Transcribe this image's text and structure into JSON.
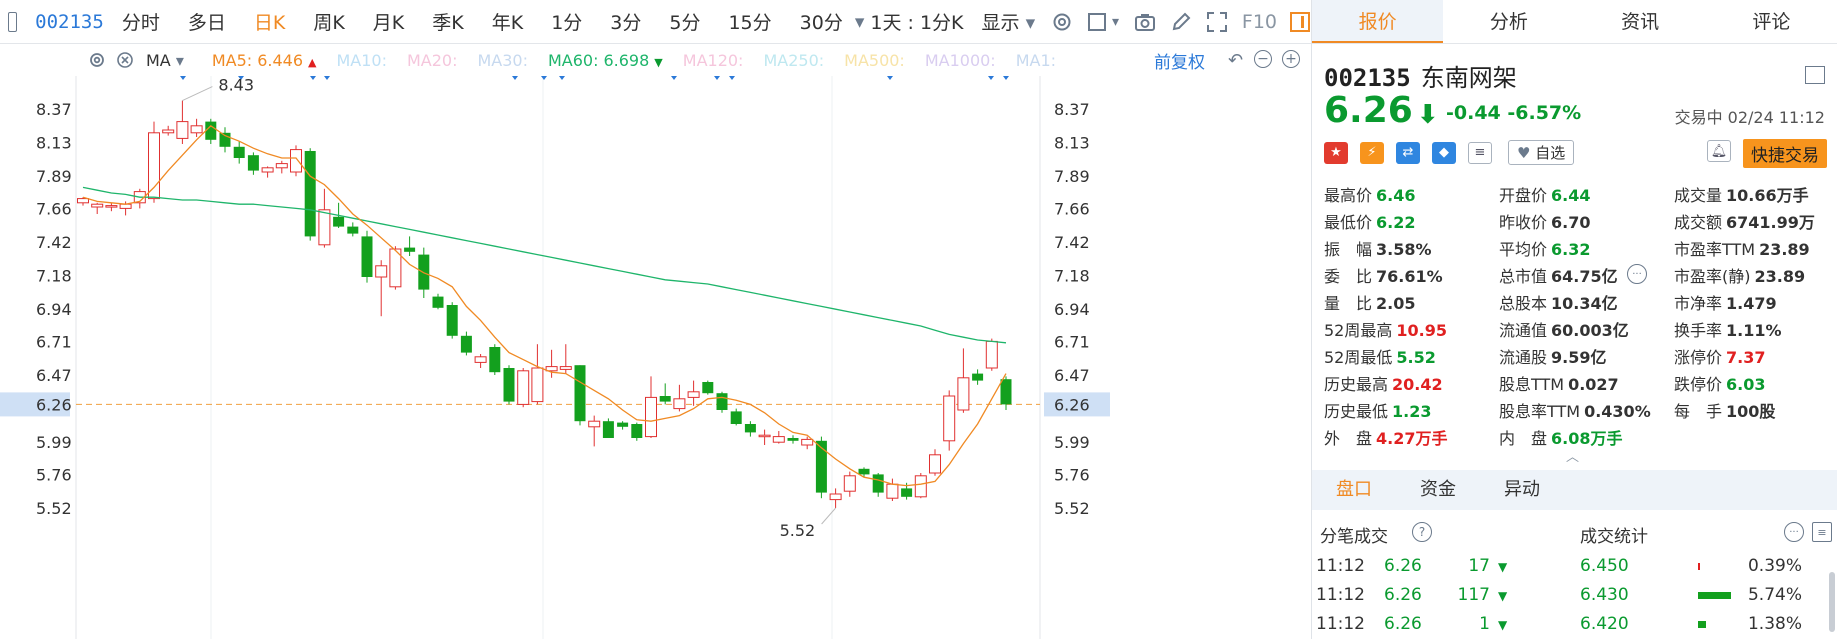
{
  "toolbar": {
    "code": "002135",
    "tabs": [
      "分时",
      "多日",
      "日K",
      "周K",
      "月K",
      "季K",
      "年K",
      "1分",
      "3分",
      "5分",
      "15分",
      "30分"
    ],
    "active_tab": "日K",
    "period_select": "1天 : 1分K",
    "display_label": "显示",
    "f10_label": "F10"
  },
  "mabar": {
    "indicator": "MA",
    "items": [
      {
        "label": "MA5:",
        "value": "6.446",
        "color": "#f08a24",
        "arrow": "▲",
        "arrow_color": "#e02020"
      },
      {
        "label": "MA10:",
        "value": "",
        "color": "#bfe0f5"
      },
      {
        "label": "MA20:",
        "value": "",
        "color": "#f5c6dc"
      },
      {
        "label": "MA30:",
        "value": "",
        "color": "#c7d9ef"
      },
      {
        "label": "MA60:",
        "value": "6.698",
        "color": "#1fb56b",
        "arrow": "▼",
        "arrow_color": "#0a9a2f"
      },
      {
        "label": "MA120:",
        "value": "",
        "color": "#f5c6dc"
      },
      {
        "label": "MA250:",
        "value": "",
        "color": "#bfe8f0"
      },
      {
        "label": "MA500:",
        "value": "",
        "color": "#f7e3a8"
      },
      {
        "label": "MA1000:",
        "value": "",
        "color": "#d9cdf0"
      },
      {
        "label": "MA1:",
        "value": "",
        "color": "#c7d9ef"
      }
    ],
    "adjust_label": "前复权"
  },
  "chart_data": {
    "type": "candlestick",
    "y_ticks": [
      "8.37",
      "8.13",
      "7.89",
      "7.66",
      "7.42",
      "7.18",
      "6.94",
      "6.71",
      "6.47",
      "6.26",
      "5.99",
      "5.76",
      "5.52"
    ],
    "ylim": [
      5.4,
      8.5
    ],
    "current_price": "6.26",
    "high_label": "8.43",
    "low_label": "5.52",
    "up_color": "#e03030",
    "down_color": "#13a01e",
    "candles": [
      [
        7.7,
        7.74,
        7.68,
        7.73
      ],
      [
        7.67,
        7.7,
        7.62,
        7.69
      ],
      [
        7.67,
        7.7,
        7.64,
        7.68
      ],
      [
        7.66,
        7.71,
        7.61,
        7.69
      ],
      [
        7.7,
        7.8,
        7.66,
        7.78
      ],
      [
        7.73,
        8.28,
        7.7,
        8.2
      ],
      [
        8.2,
        8.25,
        8.18,
        8.22
      ],
      [
        8.16,
        8.43,
        8.12,
        8.28
      ],
      [
        8.2,
        8.3,
        8.17,
        8.25
      ],
      [
        8.28,
        8.3,
        8.12,
        8.15
      ],
      [
        8.2,
        8.24,
        8.06,
        8.1
      ],
      [
        8.1,
        8.14,
        7.98,
        8.02
      ],
      [
        8.04,
        8.06,
        7.9,
        7.93
      ],
      [
        7.92,
        7.96,
        7.88,
        7.95
      ],
      [
        7.95,
        8.0,
        7.91,
        7.98
      ],
      [
        7.92,
        8.11,
        7.89,
        8.08
      ],
      [
        8.07,
        8.09,
        7.43,
        7.46
      ],
      [
        7.4,
        7.8,
        7.38,
        7.65
      ],
      [
        7.6,
        7.7,
        7.52,
        7.53
      ],
      [
        7.53,
        7.56,
        7.46,
        7.48
      ],
      [
        7.46,
        7.5,
        7.13,
        7.17
      ],
      [
        7.17,
        7.29,
        6.89,
        7.25
      ],
      [
        7.1,
        7.39,
        7.08,
        7.37
      ],
      [
        7.38,
        7.46,
        7.32,
        7.35
      ],
      [
        7.33,
        7.38,
        7.02,
        7.08
      ],
      [
        7.03,
        7.05,
        6.94,
        6.95
      ],
      [
        6.97,
        6.99,
        6.73,
        6.75
      ],
      [
        6.75,
        6.78,
        6.61,
        6.63
      ],
      [
        6.56,
        6.62,
        6.52,
        6.6
      ],
      [
        6.67,
        6.69,
        6.47,
        6.49
      ],
      [
        6.52,
        6.54,
        6.26,
        6.28
      ],
      [
        6.26,
        6.52,
        6.24,
        6.5
      ],
      [
        6.28,
        6.69,
        6.26,
        6.52
      ],
      [
        6.5,
        6.65,
        6.45,
        6.53
      ],
      [
        6.51,
        6.69,
        6.48,
        6.53
      ],
      [
        6.54,
        6.54,
        6.11,
        6.14
      ],
      [
        6.1,
        6.18,
        5.96,
        6.14
      ],
      [
        6.14,
        6.16,
        6.02,
        6.02
      ],
      [
        6.13,
        6.14,
        6.08,
        6.1
      ],
      [
        6.12,
        6.13,
        6.0,
        6.02
      ],
      [
        6.03,
        6.46,
        6.02,
        6.31
      ],
      [
        6.32,
        6.41,
        6.26,
        6.28
      ],
      [
        6.23,
        6.4,
        6.21,
        6.3
      ],
      [
        6.31,
        6.43,
        6.25,
        6.35
      ],
      [
        6.42,
        6.43,
        6.33,
        6.34
      ],
      [
        6.34,
        6.35,
        6.2,
        6.22
      ],
      [
        6.21,
        6.23,
        6.11,
        6.12
      ],
      [
        6.12,
        6.14,
        6.03,
        6.06
      ],
      [
        6.03,
        6.08,
        5.97,
        6.04
      ],
      [
        5.99,
        6.07,
        5.98,
        6.03
      ],
      [
        6.02,
        6.04,
        5.98,
        6.0
      ],
      [
        5.97,
        6.03,
        5.94,
        6.01
      ],
      [
        6.0,
        6.03,
        5.59,
        5.63
      ],
      [
        5.58,
        5.66,
        5.52,
        5.62
      ],
      [
        5.64,
        5.78,
        5.6,
        5.75
      ],
      [
        5.8,
        5.81,
        5.74,
        5.76
      ],
      [
        5.76,
        5.77,
        5.6,
        5.63
      ],
      [
        5.59,
        5.73,
        5.57,
        5.69
      ],
      [
        5.66,
        5.7,
        5.58,
        5.6
      ],
      [
        5.6,
        5.77,
        5.59,
        5.75
      ],
      [
        5.77,
        5.94,
        5.75,
        5.9
      ],
      [
        6.0,
        6.36,
        5.93,
        6.32
      ],
      [
        6.22,
        6.66,
        6.2,
        6.45
      ],
      [
        6.48,
        6.51,
        6.4,
        6.43
      ],
      [
        6.52,
        6.73,
        6.5,
        6.71
      ],
      [
        6.44,
        6.46,
        6.22,
        6.26
      ]
    ],
    "ma5": [
      7.74,
      7.71,
      7.7,
      7.69,
      7.71,
      7.81,
      7.93,
      8.04,
      8.15,
      8.25,
      8.18,
      8.14,
      8.09,
      8.05,
      8.02,
      8.02,
      7.89,
      7.83,
      7.73,
      7.62,
      7.54,
      7.45,
      7.36,
      7.26,
      7.2,
      7.16,
      7.1,
      6.96,
      6.86,
      6.74,
      6.63,
      6.58,
      6.53,
      6.49,
      6.48,
      6.42,
      6.36,
      6.3,
      6.22,
      6.15,
      6.14,
      6.16,
      6.18,
      6.23,
      6.3,
      6.31,
      6.29,
      6.26,
      6.2,
      6.12,
      6.06,
      6.04,
      5.95,
      5.87,
      5.8,
      5.74,
      5.72,
      5.69,
      5.68,
      5.69,
      5.71,
      5.83,
      5.98,
      6.12,
      6.3,
      6.48
    ],
    "ma60": [
      7.81,
      7.79,
      7.77,
      7.76,
      7.74,
      7.74,
      7.73,
      7.72,
      7.72,
      7.71,
      7.7,
      7.69,
      7.69,
      7.68,
      7.67,
      7.66,
      7.65,
      7.63,
      7.61,
      7.59,
      7.57,
      7.55,
      7.53,
      7.51,
      7.49,
      7.47,
      7.45,
      7.43,
      7.41,
      7.39,
      7.37,
      7.35,
      7.33,
      7.31,
      7.29,
      7.27,
      7.25,
      7.23,
      7.21,
      7.19,
      7.17,
      7.15,
      7.14,
      7.13,
      7.12,
      7.1,
      7.08,
      7.06,
      7.04,
      7.02,
      7.0,
      6.98,
      6.96,
      6.94,
      6.92,
      6.9,
      6.88,
      6.86,
      6.84,
      6.82,
      6.79,
      6.76,
      6.74,
      6.72,
      6.71,
      6.7
    ]
  },
  "right": {
    "tabs": [
      "报价",
      "分析",
      "资讯",
      "评论"
    ],
    "active_tab": "报价",
    "code": "002135",
    "name": "东南网架",
    "price": "6.26",
    "arrow": "⬇",
    "change": "-0.44",
    "change_pct": "-6.57%",
    "status": "交易中 02/24 11:12",
    "watch_label": "自选",
    "quick_trade": "快捷交易",
    "quote_rows": [
      [
        {
          "l": "最高价",
          "v": "6.46",
          "c": "green"
        },
        {
          "l": "开盘价",
          "v": "6.44",
          "c": "green"
        },
        {
          "l": "成交量",
          "v": "10.66",
          "u": "万手",
          "c": "dark"
        }
      ],
      [
        {
          "l": "最低价",
          "v": "6.22",
          "c": "green"
        },
        {
          "l": "昨收价",
          "v": "6.70",
          "c": "dark"
        },
        {
          "l": "成交额",
          "v": "6741.99",
          "u": "万",
          "c": "dark"
        }
      ],
      [
        {
          "l": "振　幅",
          "v": "3.58%",
          "c": "dark"
        },
        {
          "l": "平均价",
          "v": "6.32",
          "c": "green"
        },
        {
          "l": "市盈率TTM",
          "v": "23.89",
          "c": "dark"
        }
      ],
      [
        {
          "l": "委　比",
          "v": "76.61%",
          "c": "dark"
        },
        {
          "l": "总市值",
          "v": "64.75亿",
          "c": "dark"
        },
        {
          "l": "市盈率(静)",
          "v": "23.89",
          "c": "dark"
        }
      ],
      [
        {
          "l": "量　比",
          "v": "2.05",
          "c": "dark"
        },
        {
          "l": "总股本",
          "v": "10.34亿",
          "c": "dark"
        },
        {
          "l": "市净率",
          "v": "1.479",
          "c": "dark"
        }
      ],
      [
        {
          "l": "52周最高",
          "v": "10.95",
          "c": "red"
        },
        {
          "l": "流通值",
          "v": "60.003亿",
          "c": "dark"
        },
        {
          "l": "换手率",
          "v": "1.11%",
          "c": "dark"
        }
      ],
      [
        {
          "l": "52周最低",
          "v": "5.52",
          "c": "green"
        },
        {
          "l": "流通股",
          "v": "9.59亿",
          "c": "dark"
        },
        {
          "l": "涨停价",
          "v": "7.37",
          "c": "red"
        }
      ],
      [
        {
          "l": "历史最高",
          "v": "20.42",
          "c": "red"
        },
        {
          "l": "股息TTM",
          "v": "0.027",
          "c": "dark"
        },
        {
          "l": "跌停价",
          "v": "6.03",
          "c": "green"
        }
      ],
      [
        {
          "l": "历史最低",
          "v": "1.23",
          "c": "green"
        },
        {
          "l": "股息率TTM",
          "v": "0.430%",
          "c": "dark"
        },
        {
          "l": "每　手",
          "v": "100股",
          "c": "dark"
        }
      ],
      [
        {
          "l": "外　盘",
          "v": "4.27",
          "u": "万手",
          "c": "red"
        },
        {
          "l": "内　盘",
          "v": "6.08",
          "u": "万手",
          "c": "green"
        },
        {
          "l": "",
          "v": "",
          "c": "dark"
        }
      ]
    ],
    "subtabs": [
      "盘口",
      "资金",
      "异动"
    ],
    "active_subtab": "盘口",
    "trades_title": "分笔成交",
    "stats_title": "成交统计",
    "trades": [
      {
        "time": "11:12",
        "price": "6.26",
        "vol": "17",
        "sp": "6.450",
        "pct": "0.39%",
        "bar": 0.03
      },
      {
        "time": "11:12",
        "price": "6.26",
        "vol": "117",
        "sp": "6.430",
        "pct": "5.74%",
        "bar": 0.55
      },
      {
        "time": "11:12",
        "price": "6.26",
        "vol": "1",
        "sp": "6.420",
        "pct": "1.38%",
        "bar": 0.14
      }
    ]
  }
}
